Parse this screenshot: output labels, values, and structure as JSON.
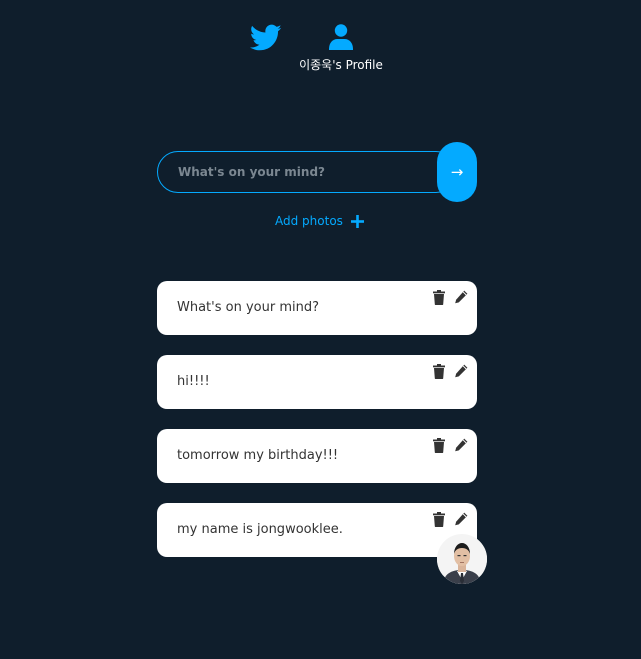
{
  "nav": {
    "home_icon": "twitter-bird-icon",
    "profile_icon": "user-icon",
    "profile_label": "이종욱's Profile"
  },
  "composer": {
    "placeholder": "What's on your mind?",
    "value": "",
    "submit_label": "→",
    "add_photos_label": "Add photos",
    "add_photos_icon": "plus-icon"
  },
  "tweets": [
    {
      "text": "What's on your mind?"
    },
    {
      "text": "hi!!!!"
    },
    {
      "text": "tomorrow my birthday!!!"
    },
    {
      "text": "my name is jongwooklee."
    }
  ],
  "colors": {
    "background": "#0f1e2c",
    "accent": "#04aaff",
    "card": "#ffffff",
    "card_text": "#333333"
  }
}
